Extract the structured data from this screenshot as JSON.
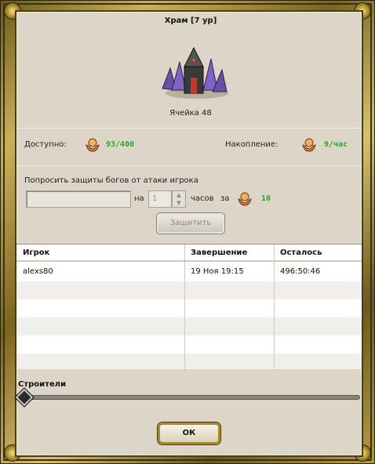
{
  "header": {
    "title": "Храм [7 ур]",
    "cell_label": "Ячейка 48"
  },
  "resources": {
    "available_label": "Доступно:",
    "available_value": "93/400",
    "accumulation_label": "Накопление:",
    "accumulation_value": "9/час"
  },
  "protect": {
    "prompt": "Попросить защиты богов от атаки игрока",
    "player_value": "",
    "na_label": "на",
    "hours_value": "1",
    "hours_label": "часов",
    "za_label": "за",
    "cost_value": "10",
    "button_label": "Защитить"
  },
  "table": {
    "headers": [
      "Игрок",
      "Завершение",
      "Осталось"
    ],
    "rows": [
      {
        "player": "alexs80",
        "end": "19 Ноя 19:15",
        "left": "496:50:46"
      }
    ]
  },
  "builders": {
    "label": "Строители",
    "slider_level": 0
  },
  "footer": {
    "ok_label": "ОК"
  },
  "colors": {
    "accent_green": "#2aa52a",
    "panel_bg": "#ddd6c8",
    "frame_gold": "#c9b15a"
  }
}
